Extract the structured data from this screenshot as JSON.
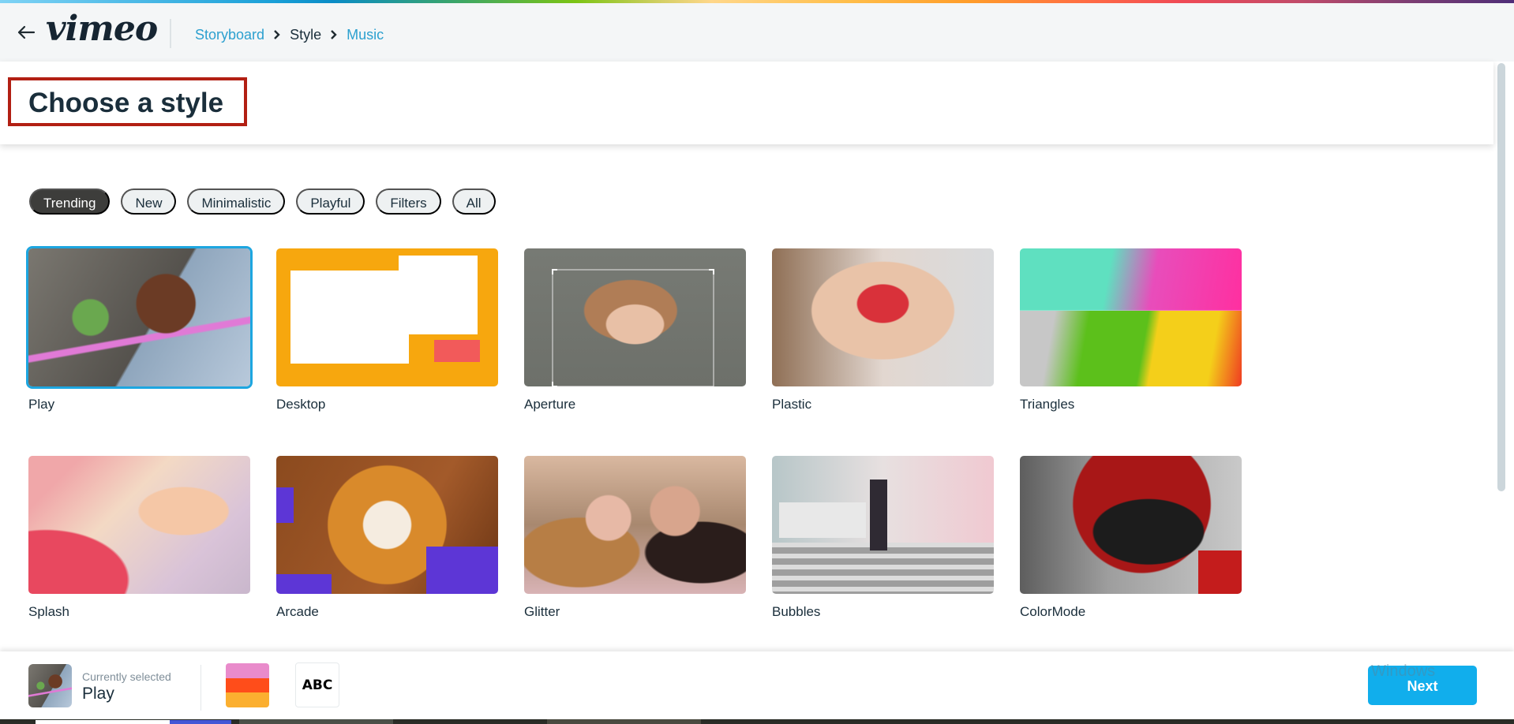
{
  "header": {
    "back_icon": "arrow-left-icon",
    "logo_text": "vimeo",
    "breadcrumb": [
      {
        "label": "Storyboard",
        "state": "link"
      },
      {
        "label": "Style",
        "state": "current"
      },
      {
        "label": "Music",
        "state": "link"
      }
    ],
    "separator_icon": "chevron-right-icon"
  },
  "page": {
    "title": "Choose a style"
  },
  "filters": {
    "chips": [
      {
        "label": "Trending",
        "active": true
      },
      {
        "label": "New",
        "active": false
      },
      {
        "label": "Minimalistic",
        "active": false
      },
      {
        "label": "Playful",
        "active": false
      },
      {
        "label": "Filters",
        "active": false
      },
      {
        "label": "All",
        "active": false
      }
    ]
  },
  "styles": [
    {
      "name": "Play",
      "selected": true
    },
    {
      "name": "Desktop",
      "selected": false
    },
    {
      "name": "Aperture",
      "selected": false
    },
    {
      "name": "Plastic",
      "selected": false
    },
    {
      "name": "Triangles",
      "selected": false
    },
    {
      "name": "Splash",
      "selected": false
    },
    {
      "name": "Arcade",
      "selected": false
    },
    {
      "name": "Glitter",
      "selected": false
    },
    {
      "name": "Bubbles",
      "selected": false
    },
    {
      "name": "ColorMode",
      "selected": false
    }
  ],
  "footer": {
    "current_caption": "Currently selected",
    "current_name": "Play",
    "palette_colors": [
      "#E98BCB",
      "#FF4D1A",
      "#FBAF30"
    ],
    "font_sample": "ABC",
    "next_label": "Next",
    "watermark": "Windows"
  },
  "colors": {
    "accent": "#11AEEC",
    "link": "#2CA0CF",
    "selected_border": "#1DA6E0",
    "active_chip": "#3D3D3B",
    "highlight_box": "#B21F13"
  }
}
